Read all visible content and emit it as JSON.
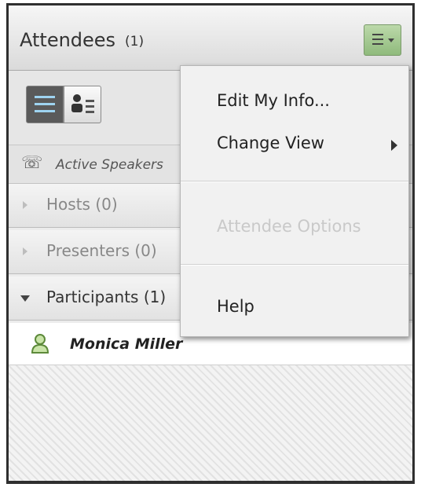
{
  "panel": {
    "title": "Attendees",
    "count": "(1)"
  },
  "active_speakers": {
    "label": "Active Speakers"
  },
  "groups": [
    {
      "label": "Hosts (0)",
      "expanded": false
    },
    {
      "label": "Presenters (0)",
      "expanded": false
    },
    {
      "label": "Participants (1)",
      "expanded": true
    }
  ],
  "attendees": [
    {
      "name": "Monica Miller",
      "icon": "person-icon"
    }
  ],
  "menu": {
    "items": [
      {
        "label": "Edit My Info...",
        "enabled": true
      },
      {
        "label": "Change View",
        "enabled": true,
        "has_submenu": true
      },
      {
        "label": "Attendee Options",
        "enabled": false
      },
      {
        "label": "Help",
        "enabled": true
      }
    ]
  },
  "colors": {
    "menu_button_accent": "#9cc488",
    "list_view_active": "#5a5a5a"
  }
}
